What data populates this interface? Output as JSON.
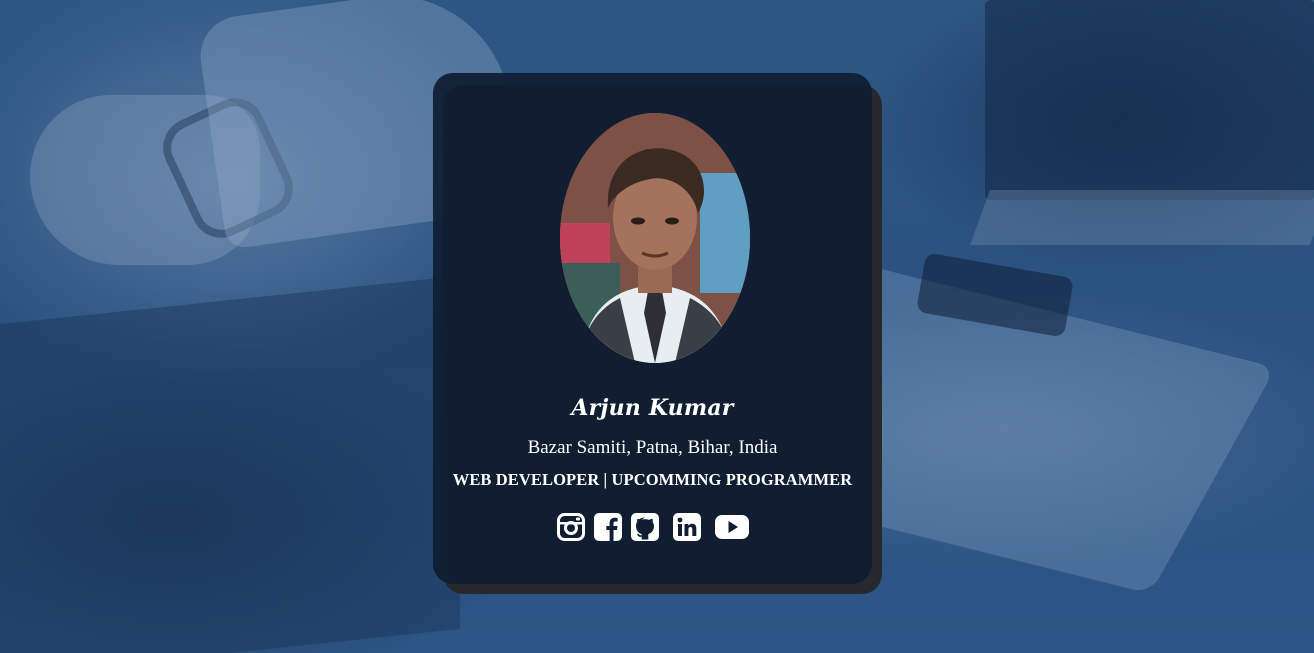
{
  "profile": {
    "name": "Arjun Kumar",
    "location": "Bazar Samiti, Patna, Bihar, India",
    "role": "WEB DEVELOPER | UPCOMMING PROGRAMMER"
  },
  "social": [
    {
      "icon": "instagram-icon"
    },
    {
      "icon": "facebook-icon"
    },
    {
      "icon": "github-icon"
    },
    {
      "icon": "linkedin-icon"
    },
    {
      "icon": "youtube-icon"
    }
  ],
  "colors": {
    "card_background": "#101d32",
    "card_shadow": "#262a2e",
    "page_overlay": "#2b5380",
    "text": "#ffffff"
  }
}
